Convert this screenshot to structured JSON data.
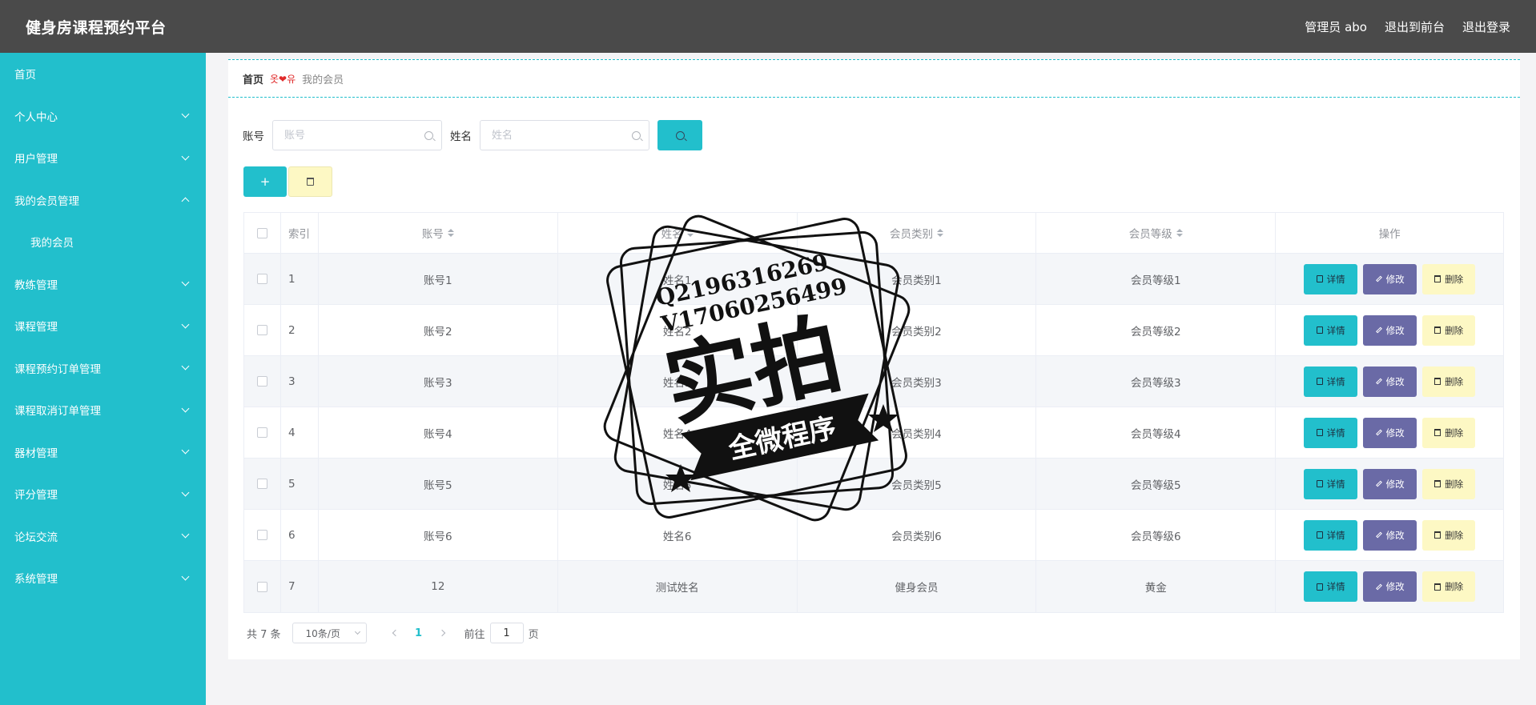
{
  "header": {
    "title": "健身房课程预约平台",
    "user": "管理员 abo",
    "to_front": "退出到前台",
    "logout": "退出登录"
  },
  "sidebar": {
    "items": [
      {
        "label": "首页",
        "chevron": "none"
      },
      {
        "label": "个人中心",
        "chevron": "down"
      },
      {
        "label": "用户管理",
        "chevron": "down"
      },
      {
        "label": "我的会员管理",
        "chevron": "up"
      },
      {
        "label": "我的会员",
        "chevron": "none",
        "sub": true
      },
      {
        "label": "教练管理",
        "chevron": "down"
      },
      {
        "label": "课程管理",
        "chevron": "down"
      },
      {
        "label": "课程预约订单管理",
        "chevron": "down"
      },
      {
        "label": "课程取消订单管理",
        "chevron": "down"
      },
      {
        "label": "器材管理",
        "chevron": "down"
      },
      {
        "label": "评分管理",
        "chevron": "down"
      },
      {
        "label": "论坛交流",
        "chevron": "down"
      },
      {
        "label": "系统管理",
        "chevron": "down"
      }
    ]
  },
  "breadcrumb": {
    "home": "首页",
    "separator": "옷❤유",
    "current": "我的会员"
  },
  "search": {
    "account_label": "账号",
    "account_placeholder": "账号",
    "name_label": "姓名",
    "name_placeholder": "姓名"
  },
  "buttons": {
    "add": "+"
  },
  "table": {
    "columns": {
      "index": "索引",
      "account": "账号",
      "name": "姓名",
      "type": "会员类别",
      "level": "会员等级",
      "ops": "操作"
    },
    "rows": [
      {
        "index": "1",
        "account": "账号1",
        "name": "姓名1",
        "type": "会员类别1",
        "level": "会员等级1"
      },
      {
        "index": "2",
        "account": "账号2",
        "name": "姓名2",
        "type": "会员类别2",
        "level": "会员等级2"
      },
      {
        "index": "3",
        "account": "账号3",
        "name": "姓名3",
        "type": "会员类别3",
        "level": "会员等级3"
      },
      {
        "index": "4",
        "account": "账号4",
        "name": "姓名4",
        "type": "会员类别4",
        "level": "会员等级4"
      },
      {
        "index": "5",
        "account": "账号5",
        "name": "姓名5",
        "type": "会员类别5",
        "level": "会员等级5"
      },
      {
        "index": "6",
        "account": "账号6",
        "name": "姓名6",
        "type": "会员类别6",
        "level": "会员等级6"
      },
      {
        "index": "7",
        "account": "12",
        "name": "测试姓名",
        "type": "健身会员",
        "level": "黄金"
      }
    ],
    "op_detail": "详情",
    "op_edit": "修改",
    "op_delete": "删除"
  },
  "pagination": {
    "total": "共 7 条",
    "page_size": "10条/页",
    "current_page": "1",
    "goto_prefix": "前往",
    "goto_value": "1",
    "goto_suffix": "页"
  },
  "watermark": {
    "line1": "Q2196316269",
    "line2": "V17060256499",
    "big": "实拍",
    "banner": "全微程序"
  },
  "colors": {
    "header_bg": "#4a4a4a",
    "sidebar_bg": "#22bfcc",
    "accent": "#22bfcc",
    "edit_button": "#6a6aa6",
    "delete_button": "#fdf8c4"
  }
}
